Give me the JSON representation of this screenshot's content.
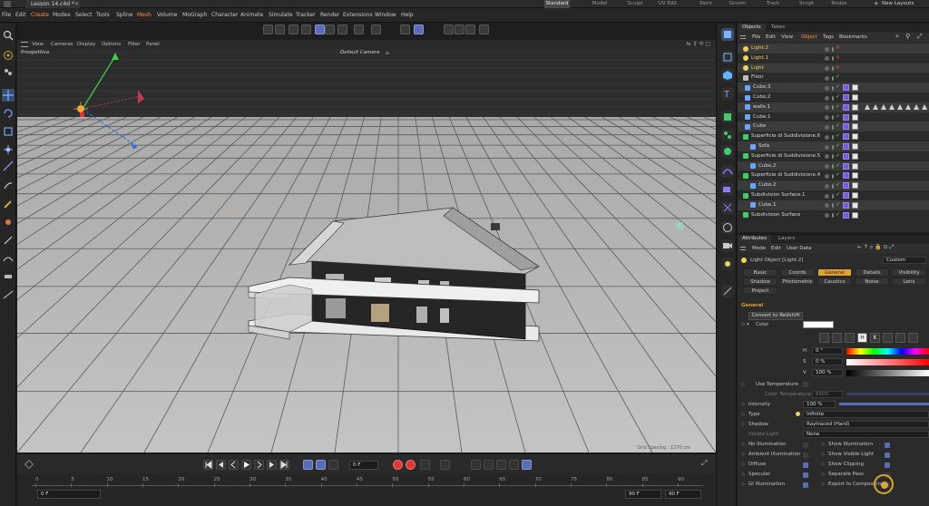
{
  "window": {
    "doc_tab": "Lesson 14.c4d *",
    "layouts": [
      "Standard",
      "Model",
      "Sculpt",
      "UV Edit",
      "Paint",
      "Groom",
      "Track",
      "Script",
      "Nodes"
    ],
    "active_layout": "Standard",
    "new_layouts": "New Layouts"
  },
  "menubar": {
    "items": [
      "File",
      "Edit",
      "Create",
      "Modes",
      "Select",
      "Tools",
      "Spline",
      "Mesh",
      "Volume",
      "MoGraph",
      "Character",
      "Animate",
      "Simulate",
      "Tracker",
      "Render",
      "Extensions",
      "Window",
      "Help"
    ],
    "highlighted": [
      "Create",
      "Mesh"
    ]
  },
  "viewport": {
    "menu": [
      "View",
      "Cameras",
      "Display",
      "Options",
      "Filter",
      "Panel"
    ],
    "projection_label": "Prospettiva",
    "camera_label": "Default Camera",
    "grid_spacing_label": "Grid Spacing : 1270 cm"
  },
  "timeline": {
    "current_frame": "0 F",
    "start_field": "0 F",
    "end_field_a": "90 F",
    "end_field_b": "90 F",
    "ticks": [
      "0",
      "5",
      "10",
      "15",
      "20",
      "25",
      "30",
      "35",
      "40",
      "45",
      "50",
      "55",
      "60",
      "65",
      "70",
      "75",
      "80",
      "85",
      "90"
    ]
  },
  "objects_panel": {
    "tabs": [
      "Objects",
      "Takes"
    ],
    "menu": [
      "File",
      "Edit",
      "View",
      "Object",
      "Tags",
      "Bookmarks"
    ],
    "highlighted_menu": "Object",
    "rows": [
      {
        "name": "Light.2",
        "type": "light"
      },
      {
        "name": "Light.1",
        "type": "light"
      },
      {
        "name": "Light",
        "type": "light"
      },
      {
        "name": "Floor",
        "type": "floor"
      },
      {
        "name": "Cubo.3",
        "type": "poly"
      },
      {
        "name": "Cubo.2",
        "type": "poly"
      },
      {
        "name": "walls.1",
        "type": "poly"
      },
      {
        "name": "Cube.1",
        "type": "poly"
      },
      {
        "name": "Cube",
        "type": "poly"
      },
      {
        "name": "Superficie di Suddivisione.6",
        "type": "subd"
      },
      {
        "name": "Sofa",
        "type": "poly"
      },
      {
        "name": "Superficie di Suddivisione.5",
        "type": "subd"
      },
      {
        "name": "Cubo.2",
        "type": "poly"
      },
      {
        "name": "Superficie di Suddivisione.4",
        "type": "subd"
      },
      {
        "name": "Cubo.2",
        "type": "poly"
      },
      {
        "name": "Subdivision Surface.1",
        "type": "subd"
      },
      {
        "name": "Cube.1",
        "type": "poly"
      },
      {
        "name": "Subdivision Surface",
        "type": "subd"
      }
    ]
  },
  "attributes_panel": {
    "tabs": [
      "Attributes",
      "Layers"
    ],
    "menu": [
      "Mode",
      "Edit",
      "User Data"
    ],
    "object_title": "Light Object [Light.2]",
    "preset": "Custom",
    "section_tabs": [
      [
        "Basic",
        "Coords",
        "General",
        "Details",
        "Visibility"
      ],
      [
        "Shadow",
        "Photometric",
        "Caustics",
        "Noise",
        "Lens"
      ],
      [
        "Project"
      ]
    ],
    "active_section": "General",
    "section_header": "General",
    "convert_button": "Convert to Redshift",
    "color_label": "Color",
    "h_label": "H",
    "h_value": "0 °",
    "s_label": "S",
    "s_value": "0 %",
    "v_label": "V",
    "v_value": "100 %",
    "use_temperature_label": "Use Temperature",
    "color_temperature_label": "Color Temperature",
    "color_temperature_value": "6500",
    "intensity_label": "Intensity",
    "intensity_value": "100 %",
    "type_label": "Type",
    "type_value": "Infinite",
    "shadow_label": "Shadow",
    "shadow_value": "Raytraced (Hard)",
    "visible_light_label": "Visible Light",
    "visible_light_value": "None",
    "checks_left": [
      "No Illumination",
      "Ambient Illumination",
      "Diffuse",
      "Specular",
      "GI Illumination"
    ],
    "checks_right": [
      "Show Illumination",
      "Show Visible Light",
      "Show Clipping",
      "Separate Pass",
      "Export to Compositing"
    ],
    "color_picker_letters": [
      "H",
      "K"
    ]
  },
  "colors": {
    "accent_orange": "#e6a032",
    "selection_blue": "#5a6cb8",
    "light_yellow": "#f0d25a"
  }
}
